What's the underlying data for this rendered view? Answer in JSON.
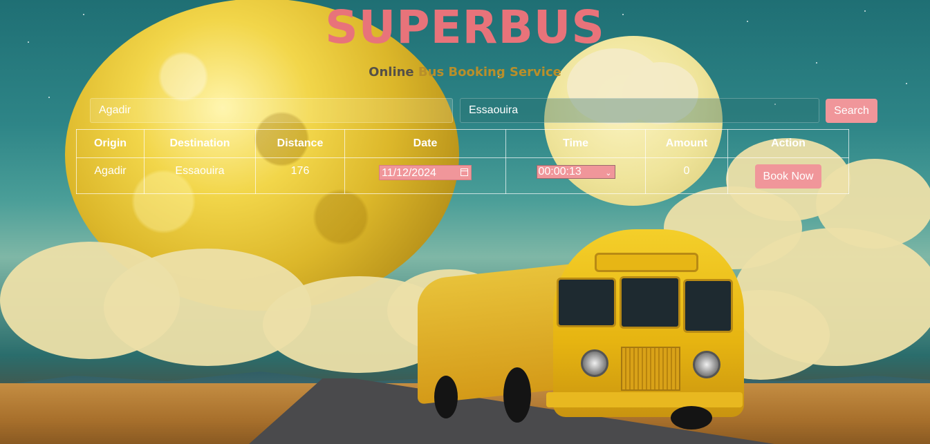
{
  "header": {
    "title": "SUPERBUS",
    "subtitle_part1": "Online",
    "subtitle_part2": "Bus Booking Service"
  },
  "search": {
    "origin_value": "Agadir",
    "destination_value": "Essaouira",
    "button_label": "Search"
  },
  "table": {
    "headers": [
      "Origin",
      "Destination",
      "Distance",
      "Date",
      "Time",
      "Amount",
      "Action"
    ],
    "rows": [
      {
        "origin": "Agadir",
        "destination": "Essaouira",
        "distance": "176",
        "date": "11/12/2024",
        "time": "00:00:13",
        "amount": "0",
        "action_label": "Book Now"
      }
    ]
  },
  "colors": {
    "accent": "#f0969a",
    "title": "#e8737a"
  }
}
